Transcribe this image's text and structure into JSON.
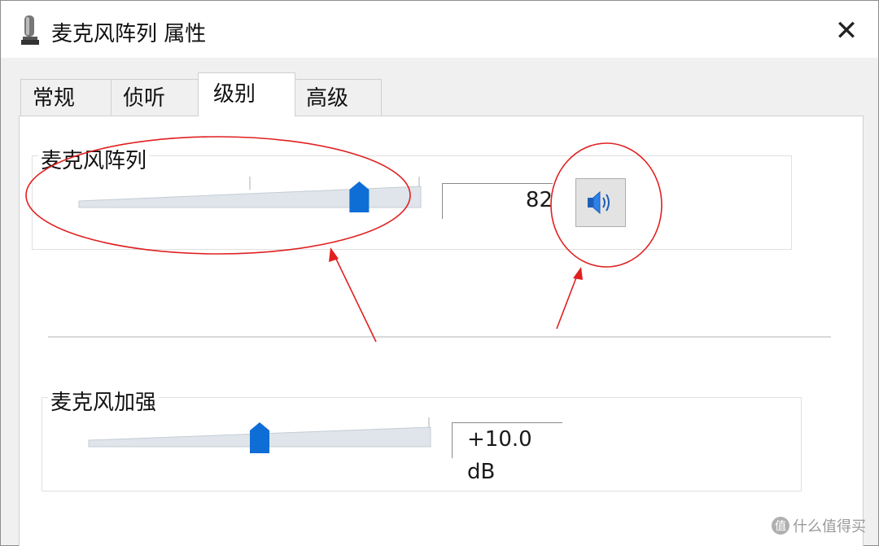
{
  "window": {
    "title": "麦克风阵列 属性",
    "close_label": "✕"
  },
  "tabs": [
    {
      "label": "常规",
      "active": false
    },
    {
      "label": "侦听",
      "active": false
    },
    {
      "label": "级别",
      "active": true
    },
    {
      "label": "高级",
      "active": false
    }
  ],
  "groups": {
    "mic_array": {
      "label": "麦克风阵列",
      "level": 82,
      "value_text": "82",
      "muted": false
    },
    "mic_boost": {
      "label": "麦克风加强",
      "value_text": "+10.0 dB",
      "level_fraction": 0.5
    }
  },
  "watermark": {
    "text": "什么值得买",
    "badge": "值"
  },
  "colors": {
    "thumb": "#0f6dd6",
    "annotation": "#e02020",
    "track": "#cfd8e0"
  }
}
